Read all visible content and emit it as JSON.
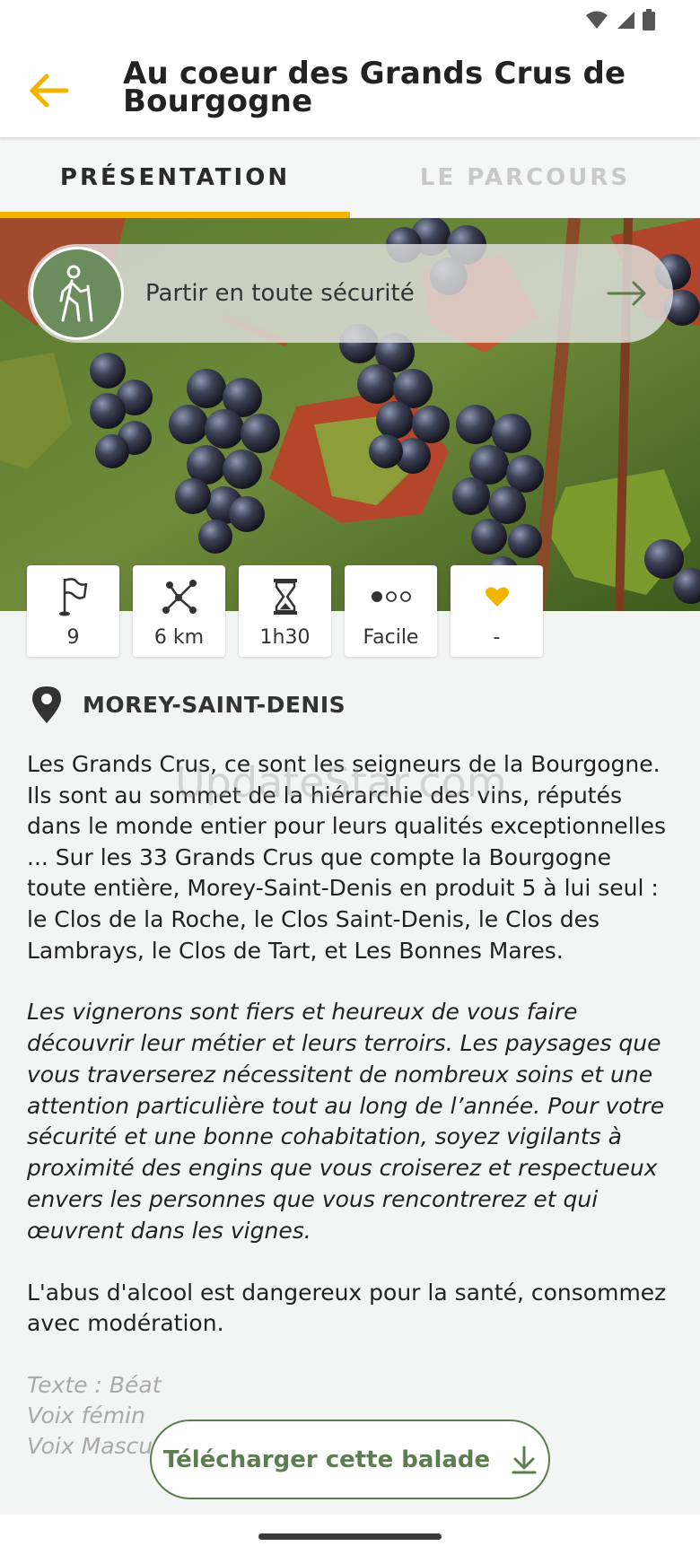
{
  "header": {
    "title": "Au coeur des Grands Crus de Bourgogne",
    "back_icon": "arrow-left-icon",
    "accent_color": "#f3b400"
  },
  "tabs": [
    {
      "label": "PRÉSENTATION",
      "active": true
    },
    {
      "label": "LE PARCOURS",
      "active": false
    }
  ],
  "safety": {
    "label": "Partir en toute sécurité",
    "icon": "hiker-icon",
    "arrow_icon": "arrow-right-icon"
  },
  "stats": [
    {
      "icon": "flag-icon",
      "value": "9"
    },
    {
      "icon": "route-icon",
      "value": "6 km"
    },
    {
      "icon": "hourglass-icon",
      "value": "1h30"
    },
    {
      "icon": "difficulty-icon",
      "value": "Facile",
      "level": 1,
      "max_level": 3
    },
    {
      "icon": "heart-icon",
      "value": "-"
    }
  ],
  "location": {
    "icon": "map-pin-icon",
    "name": "MOREY-SAINT-DENIS"
  },
  "description": {
    "paragraph1": "Les Grands Crus, ce sont les seigneurs de la Bourgogne. Ils sont au sommet de la hiérarchie des vins, réputés dans le monde entier pour leurs qualités exceptionnelles ... Sur les 33 Grands Crus que compte la Bourgogne toute entière, Morey-Saint-Denis en produit 5 à lui seul : le Clos de la Roche, le Clos Saint-Denis, le Clos des Lambrays, le Clos de Tart, et Les Bonnes Mares.",
    "paragraph2": "Les vignerons sont fiers et heureux de vous faire découvrir leur métier et leurs terroirs. Les paysages que vous traverserez nécessitent de nombreux soins et une attention particulière tout au long de l’année. Pour votre sécurité et une bonne cohabitation, soyez vigilants à proximité des engins que vous croiserez et respectueux envers les personnes que vous rencontrerez et qui œuvrent dans les vignes.",
    "paragraph3": "L'abus d'alcool est dangereux pour la santé, consommez avec modération.",
    "credit1": "Texte : Béat",
    "credit2": "Voix fémin",
    "credit3": "Voix Masculine : François Bertrand"
  },
  "watermark": "UpdateStar.com",
  "download": {
    "label": "Télécharger cette balade",
    "icon": "download-icon",
    "color": "#5b7d4f"
  }
}
